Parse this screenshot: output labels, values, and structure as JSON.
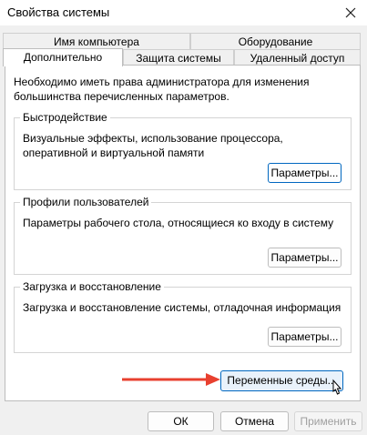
{
  "window": {
    "title": "Свойства системы"
  },
  "tabs_top": [
    "Имя компьютера",
    "Оборудование"
  ],
  "tabs_bottom": [
    "Дополнительно",
    "Защита системы",
    "Удаленный доступ"
  ],
  "panel": {
    "notice": "Необходимо иметь права администратора для изменения большинства перечисленных параметров.",
    "performance": {
      "title": "Быстродействие",
      "text": "Визуальные эффекты, использование процессора, оперативной и виртуальной памяти",
      "button": "Параметры..."
    },
    "profiles": {
      "title": "Профили пользователей",
      "text": "Параметры рабочего стола, относящиеся ко входу в систему",
      "button": "Параметры..."
    },
    "startup": {
      "title": "Загрузка и восстановление",
      "text": "Загрузка и восстановление системы, отладочная информация",
      "button": "Параметры..."
    },
    "env_button": "Переменные среды..."
  },
  "footer": {
    "ok": "ОК",
    "cancel": "Отмена",
    "apply": "Применить"
  },
  "colors": {
    "accent": "#0067c0",
    "arrow": "#e8402f"
  }
}
